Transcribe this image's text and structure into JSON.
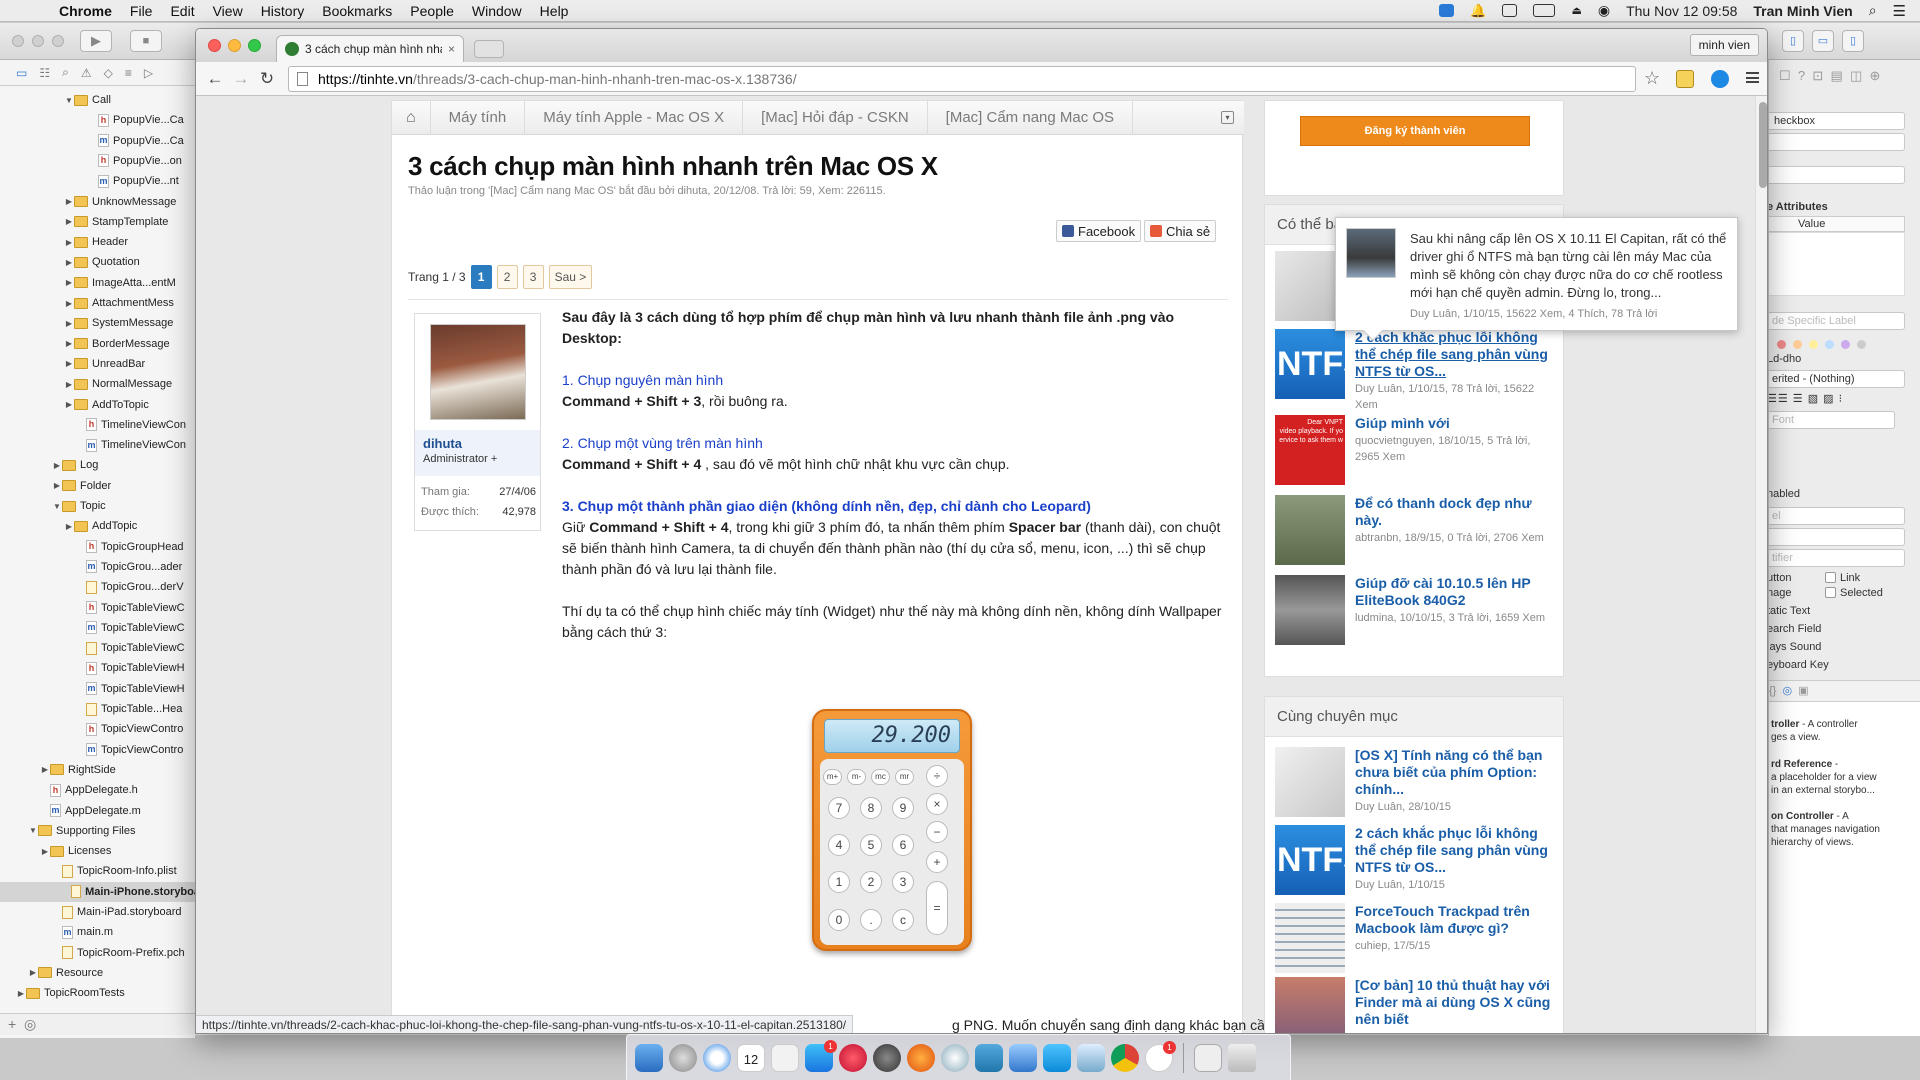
{
  "menubar": {
    "apple": "",
    "app": "Chrome",
    "items": [
      "File",
      "Edit",
      "View",
      "History",
      "Bookmarks",
      "People",
      "Window",
      "Help"
    ],
    "datetime": "Thu Nov 12  09:58",
    "user": "Tran Minh Vien"
  },
  "xcode_navigator": {
    "rows": [
      {
        "label": "Call",
        "kind": "folder",
        "open": true,
        "depth": 3
      },
      {
        "label": "PopupVie...Ca",
        "kind": "h",
        "depth": 5
      },
      {
        "label": "PopupVie...Ca",
        "kind": "m",
        "depth": 5
      },
      {
        "label": "PopupVie...on",
        "kind": "h",
        "depth": 5
      },
      {
        "label": "PopupVie...nt",
        "kind": "m",
        "depth": 5
      },
      {
        "label": "UnknowMessage",
        "kind": "folder",
        "open": false,
        "depth": 3
      },
      {
        "label": "StampTemplate",
        "kind": "folder",
        "open": false,
        "depth": 3
      },
      {
        "label": "Header",
        "kind": "folder",
        "open": false,
        "depth": 3
      },
      {
        "label": "Quotation",
        "kind": "folder",
        "open": false,
        "depth": 3
      },
      {
        "label": "ImageAtta...entM",
        "kind": "folder",
        "open": false,
        "depth": 3
      },
      {
        "label": "AttachmentMess",
        "kind": "folder",
        "open": false,
        "depth": 3
      },
      {
        "label": "SystemMessage",
        "kind": "folder",
        "open": false,
        "depth": 3
      },
      {
        "label": "BorderMessage",
        "kind": "folder",
        "open": false,
        "depth": 3
      },
      {
        "label": "UnreadBar",
        "kind": "folder",
        "open": false,
        "depth": 3
      },
      {
        "label": "NormalMessage",
        "kind": "folder",
        "open": false,
        "depth": 3
      },
      {
        "label": "AddToTopic",
        "kind": "folder",
        "open": false,
        "depth": 3
      },
      {
        "label": "TimelineViewCon",
        "kind": "h",
        "depth": 4
      },
      {
        "label": "TimelineViewCon",
        "kind": "m",
        "depth": 4
      },
      {
        "label": "Log",
        "kind": "folder",
        "open": false,
        "depth": 2
      },
      {
        "label": "Folder",
        "kind": "folder",
        "open": false,
        "depth": 2
      },
      {
        "label": "Topic",
        "kind": "folder",
        "open": true,
        "depth": 2
      },
      {
        "label": "AddTopic",
        "kind": "folder",
        "open": false,
        "depth": 3
      },
      {
        "label": "TopicGroupHead",
        "kind": "h",
        "depth": 4
      },
      {
        "label": "TopicGrou...ader",
        "kind": "m",
        "depth": 4
      },
      {
        "label": "TopicGrou...derV",
        "kind": "s",
        "depth": 4
      },
      {
        "label": "TopicTableViewC",
        "kind": "h",
        "depth": 4
      },
      {
        "label": "TopicTableViewC",
        "kind": "m",
        "depth": 4
      },
      {
        "label": "TopicTableViewC",
        "kind": "s",
        "depth": 4
      },
      {
        "label": "TopicTableViewH",
        "kind": "h",
        "depth": 4
      },
      {
        "label": "TopicTableViewH",
        "kind": "m",
        "depth": 4
      },
      {
        "label": "TopicTable...Hea",
        "kind": "s",
        "depth": 4
      },
      {
        "label": "TopicViewContro",
        "kind": "h",
        "depth": 4
      },
      {
        "label": "TopicViewContro",
        "kind": "m",
        "depth": 4
      },
      {
        "label": "RightSide",
        "kind": "folder",
        "open": false,
        "depth": 1
      },
      {
        "label": "AppDelegate.h",
        "kind": "h",
        "depth": 1
      },
      {
        "label": "AppDelegate.m",
        "kind": "m",
        "depth": 1
      },
      {
        "label": "Supporting Files",
        "kind": "folder",
        "open": true,
        "depth": 0
      },
      {
        "label": "Licenses",
        "kind": "folder",
        "open": false,
        "depth": 1
      },
      {
        "label": "TopicRoom-Info.plist",
        "kind": "s",
        "depth": 2
      },
      {
        "label": "Main-iPhone.storyboa",
        "kind": "s",
        "depth": 2,
        "selected": true
      },
      {
        "label": "Main-iPad.storyboard",
        "kind": "s",
        "depth": 2
      },
      {
        "label": "main.m",
        "kind": "m",
        "depth": 2
      },
      {
        "label": "TopicRoom-Prefix.pch",
        "kind": "s",
        "depth": 2
      },
      {
        "label": "Resource",
        "kind": "folder",
        "open": false,
        "depth": 0
      },
      {
        "label": "TopicRoomTests",
        "kind": "folder",
        "open": false,
        "depth": -1
      }
    ]
  },
  "xcode_inspector": {
    "class_field": "heckbox",
    "attributes_header": "e Attributes",
    "value_header": "Value",
    "label_placeholder": "de Specific Label",
    "id_field": "Ld-dho",
    "inherited": "erited - (Nothing)",
    "font_placeholder": "Font",
    "enabled": "nabled",
    "el_placeholder": "el",
    "tifier_placeholder": "tifier",
    "traits": [
      {
        "left": "utton",
        "right": "Link"
      },
      {
        "left": "nage",
        "right": "Selected"
      }
    ],
    "trait_list": [
      "tatic Text",
      "earch Field",
      "lays Sound",
      "eyboard Key"
    ],
    "library": [
      {
        "title": "troller",
        "rest": " - A controller",
        "desc": "ges a view."
      },
      {
        "title": "rd Reference",
        "rest": " -",
        "desc": "a placeholder for a view\nin an external storybo..."
      },
      {
        "title": "on Controller",
        "rest": " - A",
        "desc": "that manages navigation\nhierarchy of views."
      }
    ]
  },
  "browser": {
    "tab_title": "3 cách chụp màn hình nha",
    "profile": "minh vien",
    "url_host": "https://tinhte.vn",
    "url_path": "/threads/3-cach-chup-man-hinh-nhanh-tren-mac-os-x.138736/",
    "status_url": "https://tinhte.vn/threads/2-cach-khac-phuc-loi-khong-the-chep-file-sang-phan-vung-ntfs-tu-os-x-10-11-el-capitan.2513180/"
  },
  "page": {
    "breadcrumbs": [
      "Máy tính",
      "Máy tính Apple - Mac OS X",
      "[Mac] Hỏi đáp - CSKN",
      "[Mac] Cẩm nang Mac OS"
    ],
    "title": "3 cách chụp màn hình nhanh trên Mac OS X",
    "meta": "Thảo luận trong '[Mac] Cẩm nang Mac OS' bắt đầu bởi dihuta, 20/12/08. Trả lời: 59, Xem: 226115.",
    "share_facebook": "Facebook",
    "share_chiase": "Chia sẻ",
    "pager_label": "Trang 1 / 3",
    "pages": [
      "1",
      "2",
      "3"
    ],
    "pager_next": "Sau >",
    "user": {
      "name": "dihuta",
      "role": "Administrator +",
      "joined_label": "Tham gia:",
      "joined": "27/4/06",
      "likes_label": "Được thích:",
      "likes": "42,978"
    },
    "post": {
      "intro": "Sau đây là 3 cách dùng tổ hợp phím để chụp màn hình và lưu nhanh thành file ảnh .png vào Desktop:",
      "s1_title": "1. Chụp nguyên màn hình",
      "s1_keys": "Command + Shift + 3",
      "s1_rest": ", rồi buông ra.",
      "s2_title": "2. Chụp một vùng trên màn hình",
      "s2_keys": "Command + Shift + 4",
      "s2_rest": " , sau đó vẽ một hình chữ nhật khu vực cần chụp.",
      "s3_title": "3. Chụp một thành phần giao diện (không dính nền, đẹp, chỉ dành cho Leopard)",
      "s3_a": "Giữ ",
      "s3_keys": "Command + Shift + 4",
      "s3_b": ", trong khi giữ 3 phím đó, ta nhấn thêm phím ",
      "s3_space": "Spacer bar",
      "s3_c": " (thanh dài), con chuột sẽ biến thành hình Camera, ta di chuyển đến thành phần nào (thí dụ cửa sổ, menu, icon, ...) thì sẽ chụp",
      "s3_d": "thành phần đó và lưu lại thành file.",
      "example": "Thí dụ ta có thể chụp hình chiếc máy tính (Widget) như thế này mà không dính nền, không dính Wallpaper bằng cách thứ 3:",
      "tail": "g PNG. Muốn chuyển sang định dạng khác bạn cần"
    },
    "calculator": {
      "display": "29.200",
      "mem_keys": [
        "m+",
        "m-",
        "mc",
        "mr"
      ],
      "keys": [
        "7",
        "8",
        "9",
        "4",
        "5",
        "6",
        "1",
        "2",
        "3",
        "0",
        ".",
        "c"
      ],
      "ops": [
        "÷",
        "×",
        "−",
        "+",
        "="
      ]
    }
  },
  "sidebar": {
    "register": "Đăng ký thành viên",
    "related_header": "Có thể bạ",
    "tooltip": {
      "text": "Sau khi nâng cấp lên OS X 10.11 El Capitan, rất có thể driver ghi ổ NTFS mà bạn từng cài lên máy Mac của mình sẽ không còn chạy được nữa do cơ chế rootless mới hạn chế quyền admin. Đừng lo, trong...",
      "meta": "Duy Luân, 1/10/15, 15622 Xem, 4 Thích, 78 Trả lời"
    },
    "related": [
      {
        "title": "2 cách khắc phục lỗi không thể chép file sang phân vùng NTFS từ OS...",
        "meta": "Duy Luân, 1/10/15, 78 Trả lời, 15622 Xem",
        "thumb": "NTFS"
      },
      {
        "title": "Giúp mình với",
        "meta": "quocvietnguyen, 18/10/15, 5 Trả lời, 2965 Xem",
        "thumb_lines": [
          "Dear VNPT",
          "video playback. If yo",
          "ervice to ask them w"
        ]
      },
      {
        "title": "Để có thanh dock đẹp như này.",
        "meta": "abtranbn, 18/9/15, 0 Trả lời, 2706 Xem"
      },
      {
        "title": "Giúp đỡ cài 10.10.5 lên HP EliteBook 840G2",
        "meta": "ludmina, 10/10/15, 3 Trả lời, 1659 Xem"
      }
    ],
    "same_header": "Cùng chuyên mục",
    "same": [
      {
        "title": "[OS X] Tính năng có thể bạn chưa biết của phím Option: chính...",
        "meta": "Duy Luân, 28/10/15"
      },
      {
        "title": "2 cách khắc phục lỗi không thể chép file sang phân vùng NTFS từ OS...",
        "meta": "Duy Luân, 1/10/15",
        "thumb": "NTFS"
      },
      {
        "title": "ForceTouch Trackpad trên Macbook làm được gì?",
        "meta": "cuhiep, 17/5/15"
      },
      {
        "title": "[Cơ bản] 10 thủ thuật hay với Finder mà ai dùng OS X cũng nên biết",
        "meta": ""
      }
    ]
  },
  "dock": {
    "calendar_day": "12",
    "badges": [
      "1",
      "1"
    ]
  }
}
